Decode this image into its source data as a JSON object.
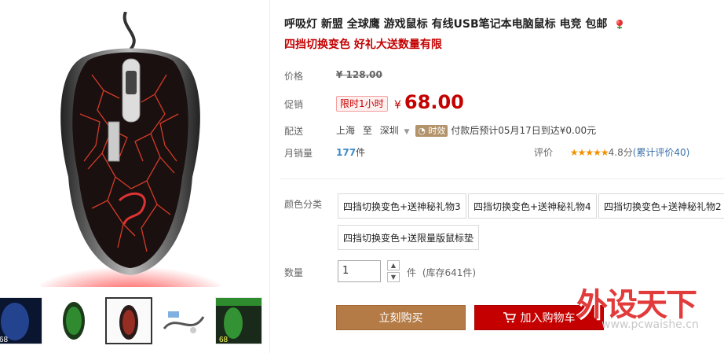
{
  "product": {
    "title": "呼吸灯 新盟 全球鹰 游戏鼠标 有线USB笔记本电脑鼠标 电竞 包邮",
    "subtitle": "四挡切换变色 好礼大送数量有限"
  },
  "labels": {
    "price": "价格",
    "promo": "促销",
    "delivery": "配送",
    "monthly_sales": "月销量",
    "rating": "评价",
    "color_category": "颜色分类",
    "quantity": "数量"
  },
  "price": {
    "currency": "¥",
    "original": "128.00",
    "promo_tag": "限时1小时",
    "current": "68.00"
  },
  "delivery": {
    "from": "上海",
    "to_word": "至",
    "to": "深圳",
    "badge": "时效",
    "estimate": "付款后预计05月17日到达¥0.00元"
  },
  "sales": {
    "count": "177",
    "unit": "件"
  },
  "rating": {
    "stars": "★★★★★",
    "score": "4.8分",
    "link": "(累计评价40)"
  },
  "options": [
    "四挡切换变色+送神秘礼物3",
    "四挡切换变色+送神秘礼物4",
    "四挡切换变色+送神秘礼物2",
    "四挡切换变色+送限量版鼠标垫"
  ],
  "quantity": {
    "value": "1",
    "unit": "件",
    "stock": "(库存641件)"
  },
  "buttons": {
    "buy_now": "立刻购买",
    "add_to_cart": "加入购物车"
  },
  "watermark": {
    "text": "外设天下",
    "url": "www.pcwaishe.cn"
  },
  "colors": {
    "accent_red": "#c40000",
    "buy_brown": "#b47b46",
    "link_blue": "#3b8ac7"
  }
}
